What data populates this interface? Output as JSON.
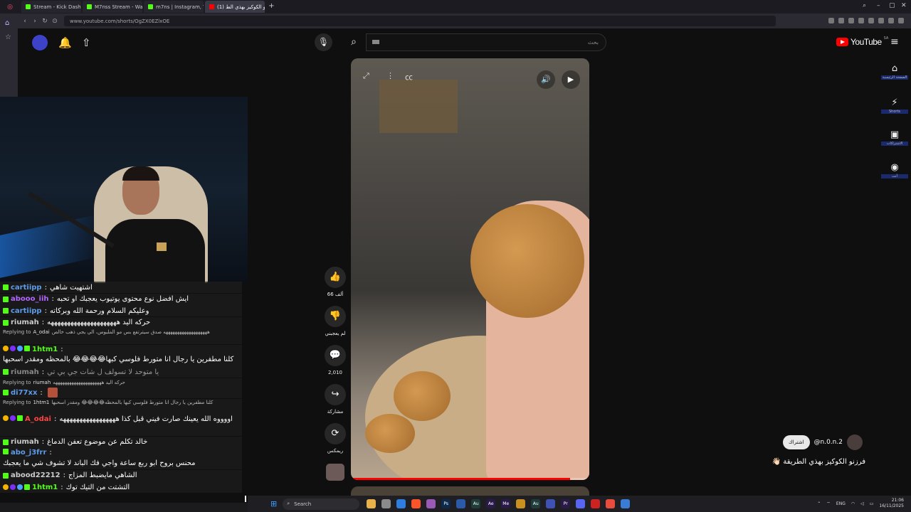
{
  "browser": {
    "tabs": [
      {
        "label": "Stream - Kick Dashboard",
        "color": "#53fc18"
      },
      {
        "label": "M7nss Stream - Watch Li",
        "color": "#53fc18"
      },
      {
        "label": "m7ns | Instagram, TikTok |",
        "color": "#53fc18"
      },
      {
        "label": "(1) فرزنو الكوكيز بهذي الط",
        "color": "#ff0000"
      }
    ],
    "new_tab": "+",
    "url": "www.youtube.com/shorts/OgZX0EZlxOE"
  },
  "youtube": {
    "search_placeholder": "بحث",
    "logo_text": "YouTube",
    "logo_region": "SA",
    "nav": [
      {
        "label": "الصفحة الرئيسية",
        "icon": "home-icon",
        "glyph": "⌂"
      },
      {
        "label": "Shorts",
        "icon": "shorts-icon",
        "glyph": "⚡"
      },
      {
        "label": "الاشتراكات",
        "icon": "subscriptions-icon",
        "glyph": "▣"
      },
      {
        "label": "أنت",
        "icon": "profile-icon",
        "glyph": "◉"
      }
    ],
    "actions": [
      {
        "label": "66 ألف",
        "icon": "like-icon",
        "glyph": "👍"
      },
      {
        "label": "لم يعجبني",
        "icon": "dislike-icon",
        "glyph": "👎"
      },
      {
        "label": "2,010",
        "icon": "comment-icon",
        "glyph": "💬"
      },
      {
        "label": "مشاركة",
        "icon": "share-icon",
        "glyph": "↪"
      },
      {
        "label": "ريمكس",
        "icon": "remix-icon",
        "glyph": "⟳"
      }
    ],
    "channel": {
      "name": "@n.0.n.2",
      "subscribe_label": "اشتراك"
    },
    "video_title": "فرزنو الكوكيز بهذي الطريقة 👋🏻",
    "progress": 0.92
  },
  "chat": [
    {
      "kind": "msg",
      "user": "cartiipp",
      "user_color": "#5d9cec",
      "text": "اشتهيت شاهي",
      "badges": [
        "kick"
      ]
    },
    {
      "kind": "msg",
      "user": "abooo_iih",
      "user_color": "#b366ff",
      "text": "ايش افضل نوع محتوى يوتيوب يعجبك او تحبه",
      "badges": [
        "kick"
      ]
    },
    {
      "kind": "msg",
      "user": "cartiipp",
      "user_color": "#5d9cec",
      "text": "وعليكم السلام ورحمة الله وبركاته",
      "badges": [
        "kick"
      ]
    },
    {
      "kind": "msg",
      "user": "riumah",
      "user_color": "#cccccc",
      "text": "حركه اليد هههههههههههههههههههههه",
      "badges": [
        "kick"
      ]
    },
    {
      "kind": "reply",
      "text": "Replying to",
      "reply_user": "A_odai",
      "reply_text": "هههههههههههههههههههه صدق سيترتفع بس مو الملبوس، الي يجي ذهب خالص",
      "tall": true
    },
    {
      "kind": "msg",
      "user": "1htm1",
      "user_color": "#53fc18",
      "text": "كلنا مطفرين يا رجال انا متورط فلوسي كبها😂😂😂😂 بالمحظه ومقدر اسحبها",
      "badges": [
        "sub",
        "mod",
        "sword",
        "kick"
      ],
      "tall": true
    },
    {
      "kind": "msg",
      "user": "riumah",
      "user_color": "#888888",
      "text": "يا متوحد لا تسولف ل شات جي بي تي",
      "badges": [
        "kick"
      ],
      "dim": true
    },
    {
      "kind": "reply",
      "text": "Replying to",
      "reply_user": "riumah",
      "reply_text": "حركه اليد هههههههههههههههههههههه"
    },
    {
      "kind": "msg",
      "user": "di77xx",
      "user_color": "#5d9cec",
      "text": "",
      "badges": [
        "kick"
      ],
      "emote": true
    },
    {
      "kind": "reply",
      "text": "Replying to",
      "reply_user": "1htm1",
      "reply_text": "كلنا مطفرين يا رجال انا متورط فلوسي كبها بالمحظه😂😂😂😂 ومقدر اسحبها",
      "tall": true
    },
    {
      "kind": "msg",
      "user": "A_odai",
      "user_color": "#ff4444",
      "text": "اووووه الله يعينك صارت فيني قبل كذا هههههههههههههههههه",
      "badges": [
        "sub",
        "mod",
        "kick"
      ],
      "tall": true
    },
    {
      "kind": "msg",
      "user": "riumah",
      "user_color": "#cccccc",
      "text": "خالد تكلم عن موضوع تعفن الدماغ",
      "badges": [
        "kick"
      ]
    },
    {
      "kind": "msg",
      "user": "abo_j3frr",
      "user_color": "#5d9cec",
      "text": "محنس بروح ابو ربع ساعة واجي فك الباند لا تشوف شي ما يعجبك",
      "badges": [
        "kick"
      ],
      "tall": true
    },
    {
      "kind": "msg",
      "user": "abood22212",
      "user_color": "#cccccc",
      "text": "الشاهي مايضبط المزاج",
      "badges": [
        "kick"
      ]
    },
    {
      "kind": "msg",
      "user": "1htm1",
      "user_color": "#53fc18",
      "text": "التشتت من التيك توك",
      "badges": [
        "sub",
        "mod",
        "sword",
        "kick"
      ]
    }
  ],
  "taskbar": {
    "search_label": "Search",
    "lang": "ENG",
    "time": "21:06",
    "date": "16/11/2025",
    "apps": [
      {
        "label": "",
        "color": "#e8b04a"
      },
      {
        "label": "",
        "color": "#8a8a8a"
      },
      {
        "label": "",
        "color": "#2f7de1"
      },
      {
        "label": "",
        "color": "#fb542b"
      },
      {
        "label": "",
        "color": "#9b59b6"
      },
      {
        "label": "Ps",
        "color": "#0b2a4d"
      },
      {
        "label": "",
        "color": "#2a5aa8"
      },
      {
        "label": "Au",
        "color": "#1f3d3a"
      },
      {
        "label": "Ae",
        "color": "#2a1a4a"
      },
      {
        "label": "Me",
        "color": "#2a1a4a"
      },
      {
        "label": "",
        "color": "#c98f1f"
      },
      {
        "label": "Au",
        "color": "#1f3d3a"
      },
      {
        "label": "",
        "color": "#3f51b5"
      },
      {
        "label": "Pr",
        "color": "#2a1a4a"
      },
      {
        "label": "",
        "color": "#5865f2"
      },
      {
        "label": "",
        "color": "#cc2222"
      },
      {
        "label": "",
        "color": "#e74c3c"
      },
      {
        "label": "",
        "color": "#3a7bd5"
      }
    ]
  }
}
